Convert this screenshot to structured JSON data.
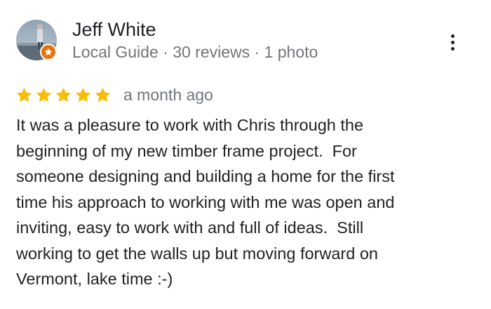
{
  "reviewer": {
    "name": "Jeff White",
    "meta": "Local Guide · 30 reviews · 1 photo",
    "avatar_icon": "reviewer-photo",
    "badge_icon": "local-guide-star-icon",
    "badge_color": "#e8710a"
  },
  "menu": {
    "icon": "more-vertical-icon"
  },
  "rating": {
    "stars": 5,
    "max_stars": 5,
    "star_color": "#fbbc04",
    "date": "a month ago"
  },
  "review": {
    "text": "It was a pleasure to work with Chris through the\nbeginning of my new timber frame project.  For\nsomeone designing and building a home for the first\ntime his approach to working with me was open and\ninviting, easy to work with and full of ideas.  Still\nworking to get the walls up but moving forward on\nVermont, lake time :-)"
  }
}
